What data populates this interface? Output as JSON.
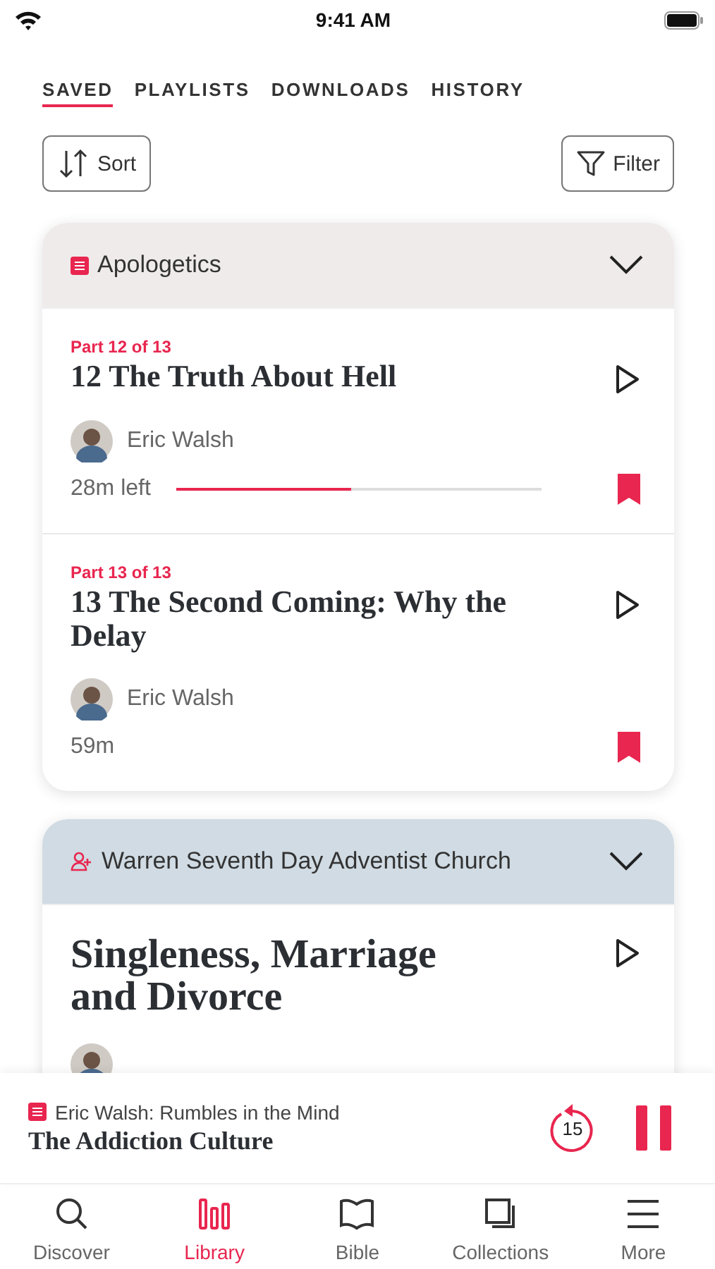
{
  "status_bar": {
    "time": "9:41 AM"
  },
  "tabs": [
    {
      "label": "SAVED",
      "selected": true
    },
    {
      "label": "PLAYLISTS",
      "selected": false
    },
    {
      "label": "DOWNLOADS",
      "selected": false
    },
    {
      "label": "HISTORY",
      "selected": false
    }
  ],
  "sort_button": "Sort",
  "filter_button": "Filter",
  "groups": [
    {
      "kind": "series",
      "title": "Apologetics",
      "color": "#efebea",
      "episodes": [
        {
          "part": "Part 12 of 13",
          "title": "12 The Truth About Hell",
          "speaker": "Eric Walsh",
          "duration": "28m left",
          "level": 0.48,
          "bookmarked": true
        },
        {
          "part": "Part 13 of 13",
          "title": "13 The Second Coming: Why the Delay",
          "speaker": "Eric Walsh",
          "duration": "59m",
          "bookmarked": true
        }
      ]
    },
    {
      "kind": "speaker",
      "title": "Warren Seventh Day Adventist Church",
      "color": "#d0dbe3",
      "episodes": [
        {
          "title": "Singleness, Marriage and Divorce",
          "large": true
        }
      ]
    }
  ],
  "player": {
    "series": "Eric Walsh: Rumbles in the Mind",
    "title": "The Addiction Culture",
    "skip": "15",
    "playing": true
  },
  "nav": [
    {
      "label": "Discover",
      "selected": false
    },
    {
      "label": "Library",
      "selected": true
    },
    {
      "label": "Bible",
      "selected": false
    },
    {
      "label": "Collections",
      "selected": false
    },
    {
      "label": "More",
      "selected": false
    }
  ]
}
